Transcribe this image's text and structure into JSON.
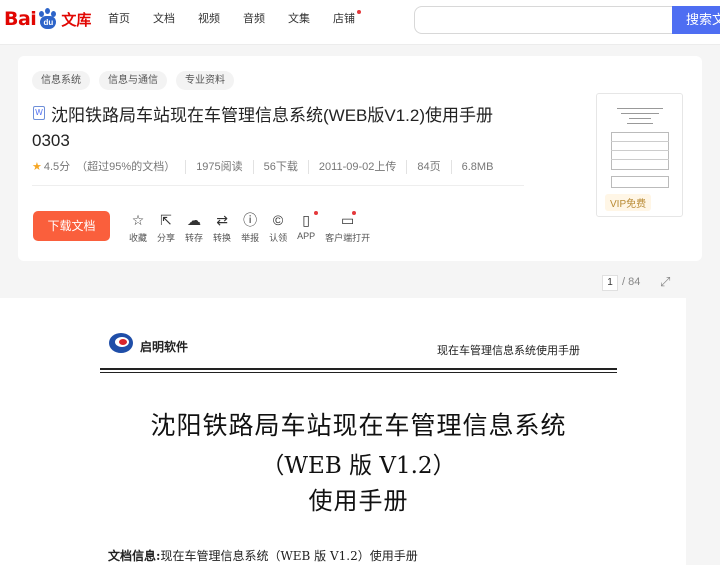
{
  "brand": {
    "logo_left": "Bai",
    "logo_paw": "du",
    "logo_right": "文库",
    "color": "#e10602"
  },
  "nav": {
    "items": [
      "首页",
      "文档",
      "视频",
      "音频",
      "文集",
      "店铺"
    ],
    "badge_item": "店铺"
  },
  "search": {
    "placeholder": "",
    "button_label": "搜索文"
  },
  "doc": {
    "tags": [
      "信息系统",
      "信息与通信",
      "专业资料"
    ],
    "type_icon": "W",
    "title": "沈阳铁路局车站现在车管理信息系统(WEB版V1.2)使用手册0303",
    "rating": "4.5分",
    "rating_note": "（超过95%的文档）",
    "reads": "1975阅读",
    "downloads": "56下载",
    "upload_date": "2011-09-02上传",
    "pages": "84页",
    "size": "6.8MB",
    "download_label": "下载文档",
    "thumbnail_badge": "VIP免费"
  },
  "actions": [
    {
      "label": "收藏",
      "icon": "star-outline-icon"
    },
    {
      "label": "分享",
      "icon": "share-icon"
    },
    {
      "label": "转存",
      "icon": "cloud-save-icon"
    },
    {
      "label": "转换",
      "icon": "convert-icon"
    },
    {
      "label": "举报",
      "icon": "report-icon"
    },
    {
      "label": "认领",
      "icon": "copyright-icon"
    },
    {
      "label": "APP",
      "icon": "phone-icon"
    },
    {
      "label": "客户端打开",
      "icon": "desktop-icon"
    }
  ],
  "reader": {
    "current_page": "1",
    "total_pages": "/ 84"
  },
  "document_page": {
    "company": "启明软件",
    "header_right": "现在车管理信息系统使用手册",
    "heading_line1": "沈阳铁路局车站现在车管理信息系统",
    "heading_line2": "（WEB 版 V1.2）",
    "heading_line3": "使用手册",
    "info_label": "文档信息:",
    "info_value": "现在车管理信息系统（WEB 版 V1.2）使用手册"
  },
  "colors": {
    "accent": "#4e6ef2",
    "download": "#fa5f3c",
    "star": "#f6a623"
  }
}
